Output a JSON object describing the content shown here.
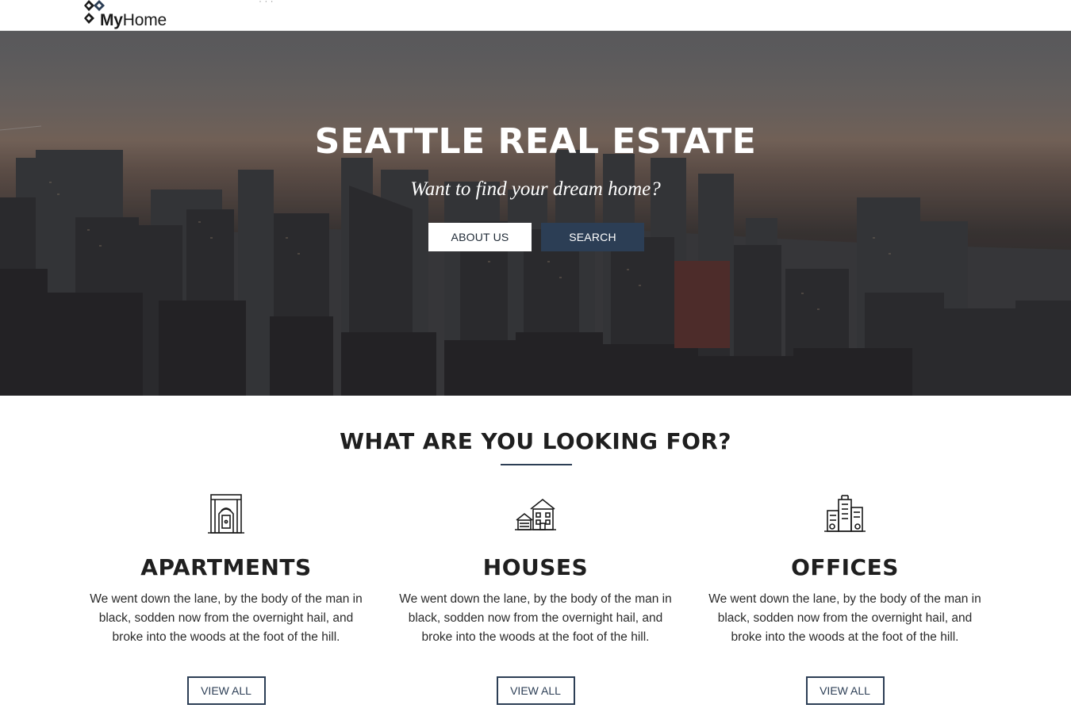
{
  "header": {
    "logo_bold": "My",
    "logo_rest": "Home",
    "nav_sliver": "·   ·   ·"
  },
  "hero": {
    "title": "SEATTLE REAL ESTATE",
    "subtitle": "Want to find your dream home?",
    "about_label": "ABOUT US",
    "search_label": "SEARCH"
  },
  "looking_for": {
    "title": "WHAT ARE YOU LOOKING FOR?",
    "categories": [
      {
        "icon": "apartment-building-icon",
        "title": "APARTMENTS",
        "description": "We went down the lane, by the body of the man in black, sodden now from the overnight hail, and broke into the woods at the foot of the hill.",
        "button_label": "VIEW ALL"
      },
      {
        "icon": "houses-icon",
        "title": "HOUSES",
        "description": "We went down the lane, by the body of the man in black, sodden now from the overnight hail, and broke into the woods at the foot of the hill.",
        "button_label": "VIEW ALL"
      },
      {
        "icon": "office-buildings-icon",
        "title": "OFFICES",
        "description": "We went down the lane, by the body of the man in black, sodden now from the overnight hail, and broke into the woods at the foot of the hill.",
        "button_label": "VIEW ALL"
      }
    ]
  },
  "colors": {
    "accent": "#2c3e55",
    "text": "#1f1f1f",
    "hero_text": "#ffffff"
  }
}
